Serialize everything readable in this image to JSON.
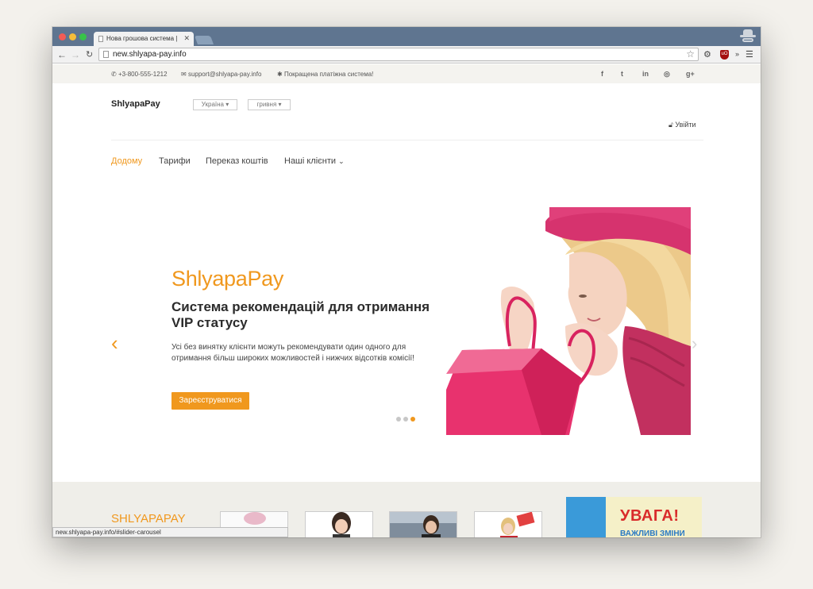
{
  "browser": {
    "tab_title": "Нова грошова система | ",
    "tab_close": "✕",
    "url": "new.shlyapa-pay.info",
    "status_url": "new.shlyapa-pay.info/#slider-carousel",
    "ublock_label": "uO"
  },
  "topbar": {
    "phone": "+3-800-555-1212",
    "email": "support@shlyapa-pay.info",
    "promo": "Покращена платіжна система!",
    "social": [
      "f",
      "t",
      "in",
      "◎",
      "g+"
    ]
  },
  "header": {
    "brand": "ShlyapaPay",
    "country_select": "Україна",
    "currency_select": "гривня",
    "login": "Увійти"
  },
  "nav": {
    "items": [
      "Додому",
      "Тарифи",
      "Переказ коштів",
      "Наші клієнти"
    ],
    "active": "Додому"
  },
  "slider": {
    "brand": "ShlyapaPay",
    "title": "Система рекомендацій для отримання VIP статусу",
    "text": "Усі без винятку клієнти можуть рекомендувати один одного для отримання більш широких можливостей і нижчих відсотків комісії!",
    "cta": "Зареєструватися",
    "active_slide": 3,
    "total_slides": 3
  },
  "bottom": {
    "title": "SHLYAPAPAY",
    "banner_line1": "УВАГА!",
    "banner_line2": "ВАЖЛИВІ ЗМІНИ"
  },
  "colors": {
    "accent": "#f0981e",
    "hero_pink": "#e8326e"
  }
}
